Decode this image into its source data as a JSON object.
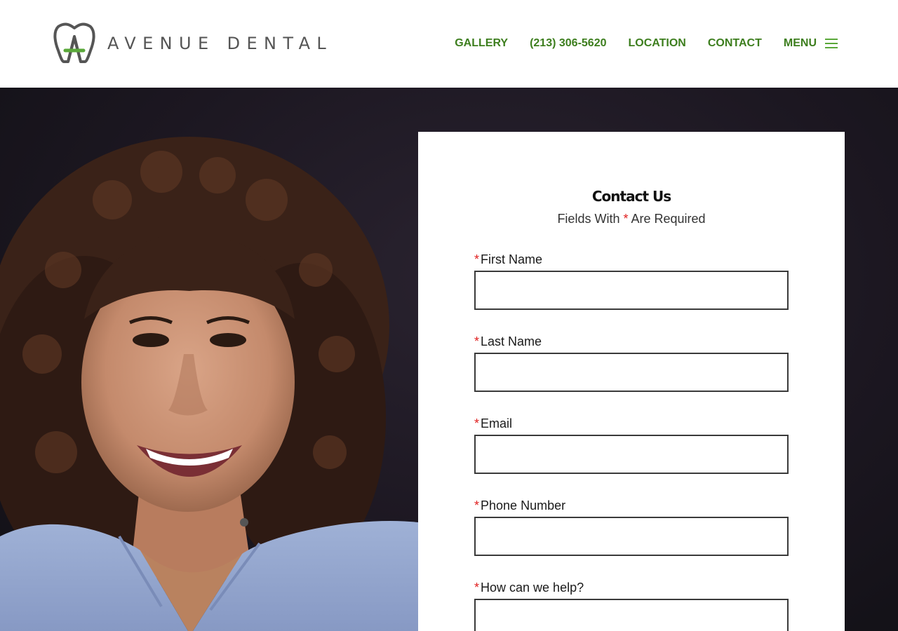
{
  "brand": {
    "name": "AVENUE DENTAL",
    "accent_color": "#3d7e1e"
  },
  "nav": {
    "gallery": "GALLERY",
    "phone": "(213) 306-5620",
    "location": "LOCATION",
    "contact": "CONTACT",
    "menu": "MENU"
  },
  "form": {
    "title": "Contact Us",
    "subtitle_before": "Fields With",
    "required_mark": "*",
    "subtitle_after": "Are Required",
    "fields": [
      {
        "label": "First Name",
        "value": ""
      },
      {
        "label": "Last Name",
        "value": ""
      },
      {
        "label": "Email",
        "value": ""
      },
      {
        "label": "Phone Number",
        "value": ""
      },
      {
        "label": "How can we help?",
        "value": ""
      }
    ]
  }
}
